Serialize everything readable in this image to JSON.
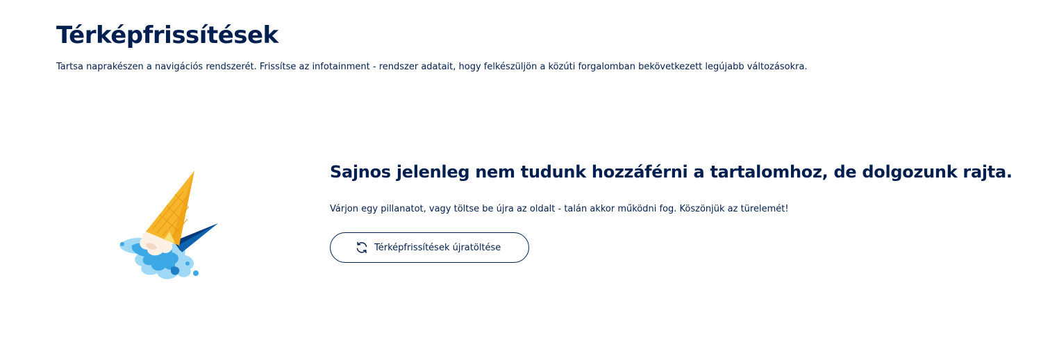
{
  "header": {
    "title": "Térképfrissítések",
    "description": "Tartsa naprakészen a navigációs rendszerét. Frissítse az infotainment - rendszer adatait, hogy felkészüljön a közúti forgalomban bekövetkezett legújabb változásokra."
  },
  "error": {
    "illustration_icon": "dropped-ice-cream-icon",
    "heading": "Sajnos jelenleg nem tudunk hozzáférni a tartalomhoz, de dolgozunk rajta.",
    "message": "Várjon egy pillanatot, vagy töltse be újra az oldalt - talán akkor működni fog. Köszönjük az türelemét!",
    "reload_button": {
      "icon": "refresh-icon",
      "label": "Térképfrissítések újratöltése"
    }
  },
  "colors": {
    "text": "#001e50",
    "background": "#ffffff",
    "cone": "#f7b52c",
    "ice_cream_light": "#9fd9f5",
    "ice_cream_mid": "#3ca8e6",
    "cone_shadow": "#003a78"
  }
}
